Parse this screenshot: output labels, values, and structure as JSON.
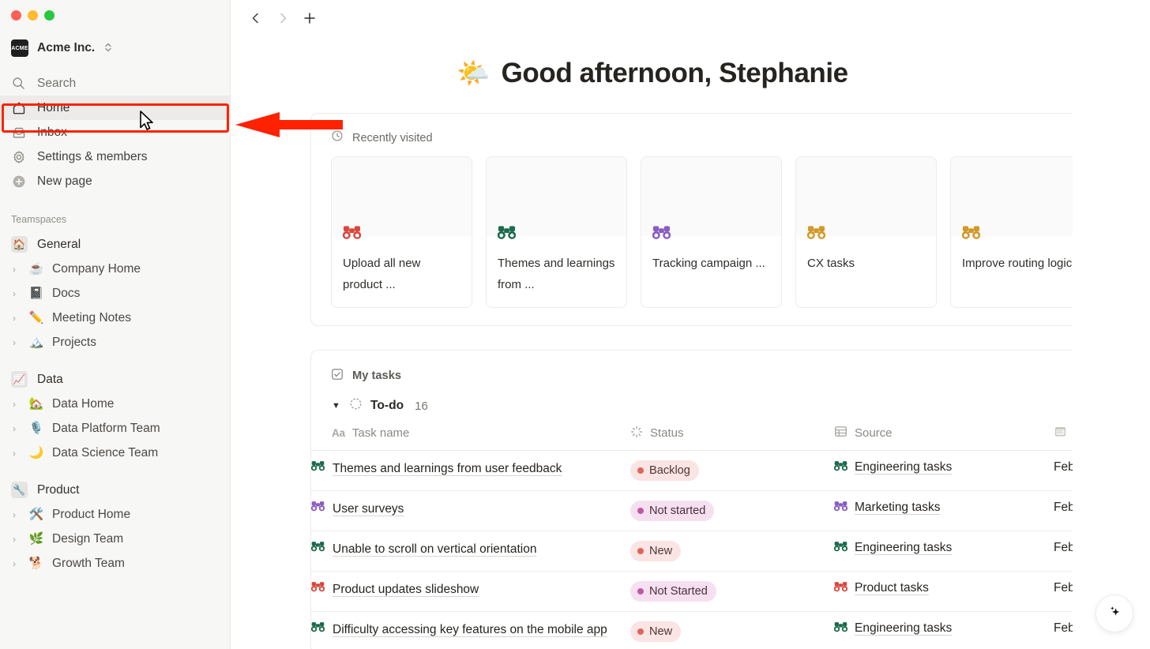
{
  "window": {
    "traffic_lights": [
      "close",
      "minimize",
      "maximize"
    ]
  },
  "sidebar": {
    "workspace": {
      "name": "Acme Inc.",
      "logo_text": "ACME",
      "chevron": "⌃⌄"
    },
    "nav": [
      {
        "label": "Search",
        "icon": "search-icon"
      },
      {
        "label": "Home",
        "icon": "home-icon",
        "active": true
      },
      {
        "label": "Inbox",
        "icon": "inbox-icon"
      },
      {
        "label": "Settings & members",
        "icon": "gear-icon"
      },
      {
        "label": "New page",
        "icon": "plus-circle-icon"
      }
    ],
    "teamspaces_label": "Teamspaces",
    "teamspaces": [
      {
        "name": "General",
        "badge": "🏠",
        "children": [
          {
            "label": "Company Home",
            "emoji": "☕"
          },
          {
            "label": "Docs",
            "emoji": "📓"
          },
          {
            "label": "Meeting Notes",
            "emoji": "✏️"
          },
          {
            "label": "Projects",
            "emoji": "🏔️"
          }
        ]
      },
      {
        "name": "Data",
        "badge": "📈",
        "children": [
          {
            "label": "Data Home",
            "emoji": "🏡"
          },
          {
            "label": "Data Platform Team",
            "emoji": "🎙️"
          },
          {
            "label": "Data Science Team",
            "emoji": "🌙"
          }
        ]
      },
      {
        "name": "Product",
        "badge": "🔧",
        "children": [
          {
            "label": "Product Home",
            "emoji": "🛠️"
          },
          {
            "label": "Design Team",
            "emoji": "🌿"
          },
          {
            "label": "Growth Team",
            "emoji": "🐕"
          }
        ]
      }
    ]
  },
  "topbar": {
    "back": "‹",
    "forward": "›",
    "new_tab": "+",
    "more": "···"
  },
  "greeting": {
    "emoji": "🌤️",
    "text": "Good afternoon, Stephanie"
  },
  "recently_visited": {
    "title": "Recently visited",
    "icon": "clock-icon",
    "cards": [
      {
        "emoji": "🔭",
        "color": "#d9483f",
        "title": "Upload all new product ..."
      },
      {
        "emoji": "🔭",
        "color": "#1d6b4c",
        "title": "Themes and learnings from ..."
      },
      {
        "emoji": "🔭",
        "color": "#8a5cc2",
        "title": "Tracking campaign ..."
      },
      {
        "emoji": "🔭",
        "color": "#d39828",
        "title": "CX tasks"
      },
      {
        "emoji": "🔭",
        "color": "#d39828",
        "title": "Improve routing logic"
      }
    ]
  },
  "my_tasks": {
    "title": "My tasks",
    "icon": "checkbox-icon",
    "group": {
      "caret": "▼",
      "name": "To-do",
      "count": "16"
    },
    "columns": [
      {
        "label": "Task name",
        "icon": "Aa"
      },
      {
        "label": "Status",
        "icon": "status-icon"
      },
      {
        "label": "Source",
        "icon": "table-icon"
      },
      {
        "label": "",
        "icon": "calendar-icon"
      }
    ],
    "rows": [
      {
        "emoji": "🔭",
        "emoji_color": "#1d6b4c",
        "name": "Themes and learnings from user feedback",
        "status": "Backlog",
        "status_style": "red",
        "source": "Engineering tasks",
        "source_color": "#1d6b4c",
        "date": "Feb"
      },
      {
        "emoji": "🔭",
        "emoji_color": "#8a5cc2",
        "name": "User surveys",
        "status": "Not started",
        "status_style": "pink",
        "source": "Marketing tasks",
        "source_color": "#8a5cc2",
        "date": "Feb"
      },
      {
        "emoji": "🔭",
        "emoji_color": "#1d6b4c",
        "name": "Unable to scroll on vertical orientation",
        "status": "New",
        "status_style": "red",
        "source": "Engineering tasks",
        "source_color": "#1d6b4c",
        "date": "Feb"
      },
      {
        "emoji": "🔭",
        "emoji_color": "#d9483f",
        "name": "Product updates slideshow",
        "status": "Not Started",
        "status_style": "pink",
        "source": "Product tasks",
        "source_color": "#d9483f",
        "date": "Feb"
      },
      {
        "emoji": "🔭",
        "emoji_color": "#1d6b4c",
        "name": "Difficulty accessing key features on the mobile app",
        "status": "New",
        "status_style": "red",
        "source": "Engineering tasks",
        "source_color": "#1d6b4c",
        "date": "Feb"
      }
    ]
  },
  "ai_button": {
    "icon": "sparkle-icon"
  },
  "annotation": {
    "color": "#ff2200",
    "target": "Home"
  }
}
